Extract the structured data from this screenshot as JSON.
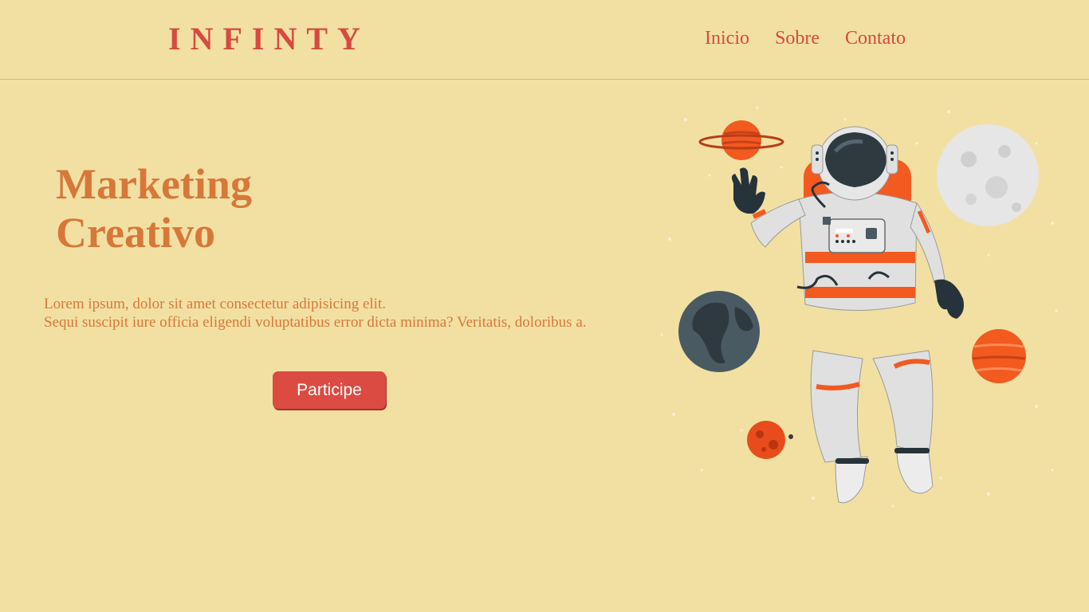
{
  "header": {
    "logo": "INFINTY",
    "nav": [
      {
        "label": "Inicio"
      },
      {
        "label": "Sobre"
      },
      {
        "label": "Contato"
      }
    ]
  },
  "hero": {
    "title_line1": "Marketing",
    "title_line2": "Creativo",
    "text_line1": "Lorem ipsum, dolor sit amet consectetur adipisicing elit.",
    "text_line2": "Sequi suscipit iure officia eligendi voluptatibus error dicta minima? Veritatis, doloribus a.",
    "cta_label": "Participe"
  },
  "illustration": {
    "subject": "astronaut-icon",
    "elements": [
      "ringed-planet-icon",
      "moon-icon",
      "earth-icon",
      "striped-planet-icon",
      "mars-icon"
    ]
  },
  "colors": {
    "background": "#f2e0a3",
    "brand": "#d64a41",
    "accent": "#d8773a",
    "button": "#db4b42"
  }
}
